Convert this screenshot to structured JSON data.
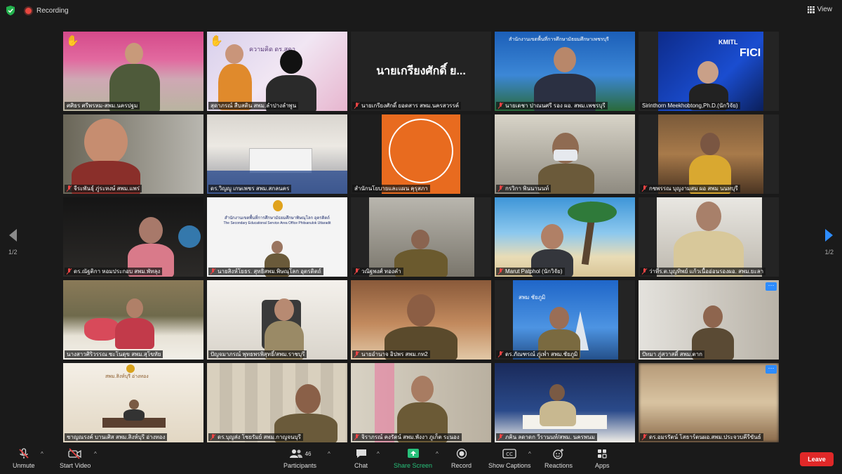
{
  "topbar": {
    "recording_label": "Recording",
    "view_label": "View"
  },
  "pager": {
    "left_label": "1/2",
    "right_label": "1/2"
  },
  "tiles": [
    {
      "name": "ศศิธร ศรีพรหม-สพม.นครปฐม",
      "muted": false
    },
    {
      "name": "สุดาภรณ์ สืบสติน สพม.ลำปางลำพูน",
      "muted": false
    },
    {
      "name": "นายเกรียงศักดิ์ ยอดสาร สพม.นครสวรรค์",
      "muted": true,
      "big_text": "นายเกรียงศักดิ์ ย..."
    },
    {
      "name": "นายเดชา ปาณนศรี รอง ผอ. สพม.เพชรบุรี",
      "muted": true
    },
    {
      "name": "Sirinthorn Meekhobtong,Ph.D.(นักวิจัย)",
      "muted": false
    },
    {
      "name": "จีระพันธุ์ ภู่ระหงษ์ สพม.แพร่",
      "muted": true
    },
    {
      "name": "ดร.วิญญู เกษเพชร สพม.สกลนคร",
      "muted": false
    },
    {
      "name": "สำนักนโยบายและแผน คุรุสภา",
      "muted": false
    },
    {
      "name": "กรวิกา พินนานนท์",
      "muted": true
    },
    {
      "name": "กชพรรณ บุญงามสม ผอ สพม นนทบุรี",
      "muted": true
    },
    {
      "name": "ดร.ณัฐติกา หอมประกอบ สพม.พัทลุง",
      "muted": true
    },
    {
      "name": "นายสิงห์โยธร. สุทธิสพม.พิษณุโลก อุตรดิตถ์",
      "muted": true
    },
    {
      "name": "วณิฐพงศ์ ทองคำ",
      "muted": true
    },
    {
      "name": "Marut Patphol (นักวิจัย)",
      "muted": true
    },
    {
      "name": "ว่าที่ร.ต.บุญทิพย์ แก้วเนื้ออ่อนรองผอ. สพม.ยะลา",
      "muted": true
    },
    {
      "name": "นางสาวศิริวรรณ ชะโนดุข สพม.สุโขทัย",
      "muted": false
    },
    {
      "name": "ปัญจมาภรณ์ พุทธพรพิสุทธิ์/สพม.ราชบุรี",
      "muted": false
    },
    {
      "name": "นายอำนาจ อิปพร สพม.กท2",
      "muted": true
    },
    {
      "name": "ดร.ภัณฑรณ์ ภู่เพ่ำ สพม.ชัยภูมิ",
      "muted": true
    },
    {
      "name": "ปัทมา ภู่สวาสดิ์ สพม.ตาก",
      "muted": false
    },
    {
      "name": "ชาญณรงค์ บานเศิส สพม.สิงห์บุรี อ่างทอง",
      "muted": false
    },
    {
      "name": "ดร.บุญส่ง โชยรัมย์ สพม.กาญจนบุรี",
      "muted": true
    },
    {
      "name": "จิราภรณ์ คงรัตน์ สพม.พังงา ภูเก็ต ระนอง",
      "muted": true
    },
    {
      "name": "ภคิน ลดาดก วีรานนท์/สพม. นครพนม",
      "muted": true
    },
    {
      "name": "ดร.อมรรัตน์ โสธาร์ตนผอ.สพม.ประจวบคีรีขันธ์",
      "muted": true
    }
  ],
  "tile_texts": {
    "t2_overlay": "ความคิด ดร.สุดา",
    "t4_banner": "สำนักงานเขตพื้นที่การศึกษามัธยมศึกษาเพชรบุรี",
    "t5_logo": "KMITL",
    "t5_logo2": "FICI",
    "t12_sign": "สำนักงานเขตพื้นที่การศึกษามัธยมศึกษาพิษณุโลก อุตรดิตถ์",
    "t12_sign_en": "The Secondary Educational Service Area Office Phitsanulok Uttaradit",
    "t19_sign": "สพม ชัยภูมิ",
    "t21_sign": "สพม.สิงห์บุรี อ่างทอง"
  },
  "toolbar": {
    "unmute": "Unmute",
    "start_video": "Start Video",
    "participants": "Participants",
    "participants_count": "46",
    "chat": "Chat",
    "share_screen": "Share Screen",
    "record": "Record",
    "show_captions": "Show Captions",
    "reactions": "Reactions",
    "apps": "Apps",
    "leave": "Leave"
  },
  "colors": {
    "accent": "#2d8cff",
    "share": "#27c07a",
    "leave": "#e02828",
    "active_border": "#c6e03a"
  }
}
